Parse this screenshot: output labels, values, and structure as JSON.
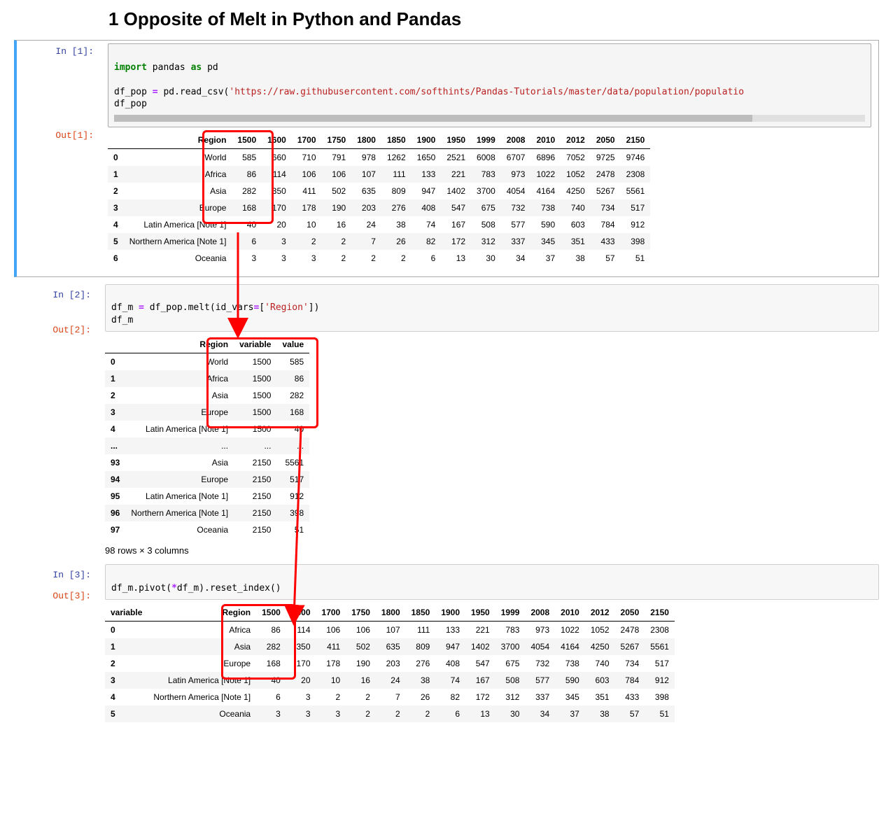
{
  "heading": "1  Opposite of Melt in Python and Pandas",
  "cells": {
    "c1": {
      "in_prompt": "In [1]:",
      "out_prompt": "Out[1]:",
      "code": {
        "kw_import": "import",
        "mod": " pandas ",
        "kw_as": "as",
        "alias": " pd",
        "line2a": "df_pop ",
        "eq": "=",
        "line2b": " pd.read_csv(",
        "str": "'https://raw.githubusercontent.com/softhints/Pandas-Tutorials/master/data/population/populatio",
        "line3": "df_pop"
      },
      "table": {
        "columns": [
          "Region",
          "1500",
          "1600",
          "1700",
          "1750",
          "1800",
          "1850",
          "1900",
          "1950",
          "1999",
          "2008",
          "2010",
          "2012",
          "2050",
          "2150"
        ],
        "index": [
          "0",
          "1",
          "2",
          "3",
          "4",
          "5",
          "6"
        ],
        "rows": [
          [
            "World",
            "585",
            "660",
            "710",
            "791",
            "978",
            "1262",
            "1650",
            "2521",
            "6008",
            "6707",
            "6896",
            "7052",
            "9725",
            "9746"
          ],
          [
            "Africa",
            "86",
            "114",
            "106",
            "106",
            "107",
            "111",
            "133",
            "221",
            "783",
            "973",
            "1022",
            "1052",
            "2478",
            "2308"
          ],
          [
            "Asia",
            "282",
            "350",
            "411",
            "502",
            "635",
            "809",
            "947",
            "1402",
            "3700",
            "4054",
            "4164",
            "4250",
            "5267",
            "5561"
          ],
          [
            "Europe",
            "168",
            "170",
            "178",
            "190",
            "203",
            "276",
            "408",
            "547",
            "675",
            "732",
            "738",
            "740",
            "734",
            "517"
          ],
          [
            "Latin America [Note 1]",
            "40",
            "20",
            "10",
            "16",
            "24",
            "38",
            "74",
            "167",
            "508",
            "577",
            "590",
            "603",
            "784",
            "912"
          ],
          [
            "Northern America [Note 1]",
            "6",
            "3",
            "2",
            "2",
            "7",
            "26",
            "82",
            "172",
            "312",
            "337",
            "345",
            "351",
            "433",
            "398"
          ],
          [
            "Oceania",
            "3",
            "3",
            "3",
            "2",
            "2",
            "2",
            "6",
            "13",
            "30",
            "34",
            "37",
            "38",
            "57",
            "51"
          ]
        ]
      }
    },
    "c2": {
      "in_prompt": "In [2]:",
      "out_prompt": "Out[2]:",
      "code": {
        "a": "df_m ",
        "eq": "=",
        "b": " df_pop.melt(id_vars",
        "eq2": "=",
        "c": "[",
        "str": "'Region'",
        "d": "])",
        "line2": "df_m"
      },
      "table": {
        "columns": [
          "Region",
          "variable",
          "value"
        ],
        "index": [
          "0",
          "1",
          "2",
          "3",
          "4",
          "...",
          "93",
          "94",
          "95",
          "96",
          "97"
        ],
        "rows": [
          [
            "World",
            "1500",
            "585"
          ],
          [
            "Africa",
            "1500",
            "86"
          ],
          [
            "Asia",
            "1500",
            "282"
          ],
          [
            "Europe",
            "1500",
            "168"
          ],
          [
            "Latin America [Note 1]",
            "1500",
            "40"
          ],
          [
            "...",
            "...",
            "..."
          ],
          [
            "Asia",
            "2150",
            "5561"
          ],
          [
            "Europe",
            "2150",
            "517"
          ],
          [
            "Latin America [Note 1]",
            "2150",
            "912"
          ],
          [
            "Northern America [Note 1]",
            "2150",
            "398"
          ],
          [
            "Oceania",
            "2150",
            "51"
          ]
        ]
      },
      "summary": "98 rows × 3 columns"
    },
    "c3": {
      "in_prompt": "In [3]:",
      "out_prompt": "Out[3]:",
      "code": {
        "a": "df_m.pivot(",
        "star": "*",
        "b": "df_m).reset_index()"
      },
      "table": {
        "index_name": "variable",
        "columns": [
          "Region",
          "1500",
          "1600",
          "1700",
          "1750",
          "1800",
          "1850",
          "1900",
          "1950",
          "1999",
          "2008",
          "2010",
          "2012",
          "2050",
          "2150"
        ],
        "index": [
          "0",
          "1",
          "2",
          "3",
          "4",
          "5"
        ],
        "rows": [
          [
            "Africa",
            "86",
            "114",
            "106",
            "106",
            "107",
            "111",
            "133",
            "221",
            "783",
            "973",
            "1022",
            "1052",
            "2478",
            "2308"
          ],
          [
            "Asia",
            "282",
            "350",
            "411",
            "502",
            "635",
            "809",
            "947",
            "1402",
            "3700",
            "4054",
            "4164",
            "4250",
            "5267",
            "5561"
          ],
          [
            "Europe",
            "168",
            "170",
            "178",
            "190",
            "203",
            "276",
            "408",
            "547",
            "675",
            "732",
            "738",
            "740",
            "734",
            "517"
          ],
          [
            "Latin America [Note 1]",
            "40",
            "20",
            "10",
            "16",
            "24",
            "38",
            "74",
            "167",
            "508",
            "577",
            "590",
            "603",
            "784",
            "912"
          ],
          [
            "Northern America [Note 1]",
            "6",
            "3",
            "2",
            "2",
            "7",
            "26",
            "82",
            "172",
            "312",
            "337",
            "345",
            "351",
            "433",
            "398"
          ],
          [
            "Oceania",
            "3",
            "3",
            "3",
            "2",
            "2",
            "2",
            "6",
            "13",
            "30",
            "34",
            "37",
            "38",
            "57",
            "51"
          ]
        ]
      }
    }
  }
}
